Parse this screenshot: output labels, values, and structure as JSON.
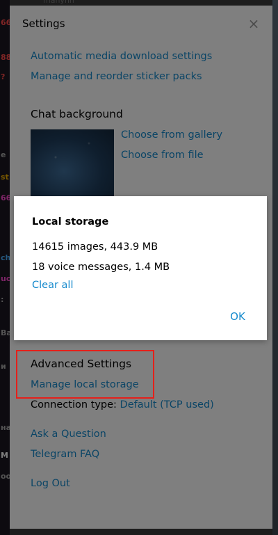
{
  "background": {
    "top_text": "manynn",
    "left_strip": [
      {
        "text": "66",
        "color": "#ff4b4b"
      },
      {
        "text": "88",
        "color": "#ff4b4b"
      },
      {
        "text": "?",
        "color": "#ff4b4b"
      },
      {
        "text": "е н",
        "color": "#aaaaaa"
      },
      {
        "text": "st",
        "color": "#f0b000"
      },
      {
        "text": "66",
        "color": "#ff4bd0"
      },
      {
        "text": "ch",
        "color": "#4bb0ff"
      },
      {
        "text": "uc",
        "color": "#ff4bd0"
      },
      {
        "text": ":",
        "color": "#aaaaaa"
      },
      {
        "text": "Ва",
        "color": "#aaaaaa"
      },
      {
        "text": "и",
        "color": "#aaaaaa"
      },
      {
        "text": "на",
        "color": "#aaaaaa"
      },
      {
        "text": "M",
        "color": "#ffffff"
      },
      {
        "text": "ooc",
        "color": "#aaaaaa"
      }
    ]
  },
  "settings": {
    "title": "Settings",
    "close_glyph": "×",
    "links": {
      "media_download": "Automatic media download settings",
      "sticker_packs": "Manage and reorder sticker packs"
    },
    "chat_background": {
      "title": "Chat background",
      "choose_gallery": "Choose from gallery",
      "choose_file": "Choose from file"
    },
    "advanced": {
      "title": "Advanced Settings",
      "manage_storage": "Manage local storage",
      "connection_label": "Connection type:",
      "connection_value": "Default (TCP used)"
    },
    "help": {
      "ask": "Ask a Question",
      "faq": "Telegram FAQ"
    },
    "logout": "Log Out"
  },
  "dialog": {
    "title": "Local storage",
    "images": "14615 images, 443.9 MB",
    "voice": "18 voice messages, 1.4 MB",
    "clear_all": "Clear all",
    "ok": "OK"
  },
  "colors": {
    "link": "#168acd",
    "highlight": "#e5201a"
  }
}
